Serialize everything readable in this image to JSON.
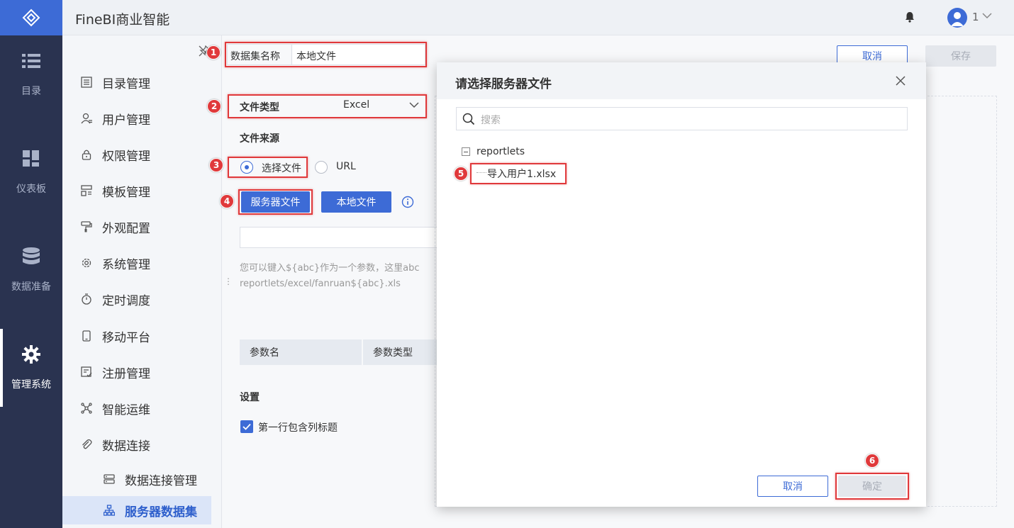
{
  "app": {
    "title": "FineBI商业智能",
    "user": "1"
  },
  "leftnav": [
    {
      "label": "目录",
      "icon": "list-icon"
    },
    {
      "label": "仪表板",
      "icon": "dashboard-icon"
    },
    {
      "label": "数据准备",
      "icon": "database-icon"
    },
    {
      "label": "管理系统",
      "icon": "gear-icon",
      "active": true
    }
  ],
  "sidebar": {
    "items": [
      {
        "label": "目录管理"
      },
      {
        "label": "用户管理"
      },
      {
        "label": "权限管理"
      },
      {
        "label": "模板管理"
      },
      {
        "label": "外观配置"
      },
      {
        "label": "系统管理"
      },
      {
        "label": "定时调度"
      },
      {
        "label": "移动平台"
      },
      {
        "label": "注册管理"
      },
      {
        "label": "智能运维"
      },
      {
        "label": "数据连接"
      },
      {
        "label": "数据连接管理"
      },
      {
        "label": "服务器数据集"
      }
    ]
  },
  "form": {
    "dataset_label": "数据集名称",
    "dataset_value": "本地文件",
    "cancel_label": "取消",
    "save_label": "保存",
    "filetype_label": "文件类型",
    "filetype_value": "Excel",
    "source_label": "文件来源",
    "radio_select": "选择文件",
    "radio_url": "URL",
    "server_file_btn": "服务器文件",
    "local_file_btn": "本地文件",
    "hint_line1": "您可以键入${abc}作为一个参数，这里abc",
    "hint_line2": "reportlets/excel/fanruan${abc}.xls",
    "param_name_header": "参数名",
    "param_type_header": "参数类型",
    "settings_label": "设置",
    "first_row_header_label": "第一行包含列标题"
  },
  "annotations": [
    "1",
    "2",
    "3",
    "4",
    "5",
    "6"
  ],
  "modal": {
    "title": "请选择服务器文件",
    "search_placeholder": "搜索",
    "tree_root": "reportlets",
    "tree_file": "导入用户1.xlsx",
    "cancel_label": "取消",
    "confirm_label": "确定"
  },
  "colors": {
    "accent": "#3d6bd6",
    "nav_bg": "#2a3350",
    "annotation": "#e0393b"
  }
}
